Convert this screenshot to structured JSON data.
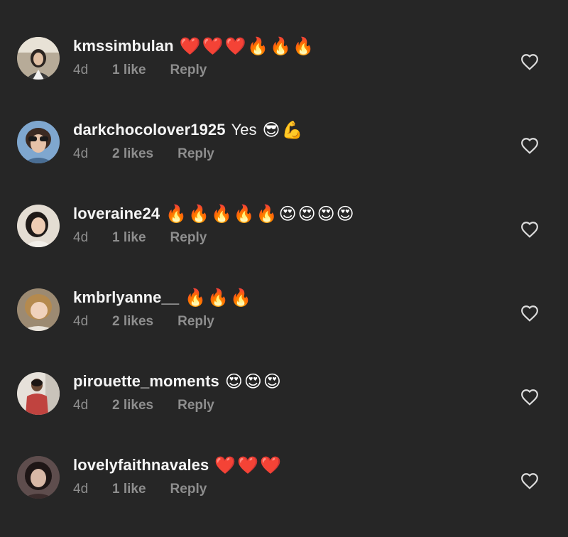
{
  "comments": [
    {
      "username": "kmssimbulan",
      "text": "",
      "emoji": "❤️❤️❤️🔥🔥🔥",
      "time": "4d",
      "likes": "1 like",
      "reply": "Reply",
      "avatar_color": "#6b5a4a"
    },
    {
      "username": "darkchocolover1925",
      "text": "Yes",
      "emoji": "😎💪",
      "time": "4d",
      "likes": "2 likes",
      "reply": "Reply",
      "avatar_color": "#5a7fa6"
    },
    {
      "username": "loveraine24",
      "text": "",
      "emoji": "🔥🔥🔥🔥🔥😍😍😍😍",
      "time": "4d",
      "likes": "1 like",
      "reply": "Reply",
      "avatar_color": "#c9b8a8"
    },
    {
      "username": "kmbrlyanne__",
      "text": "",
      "emoji": "🔥🔥🔥",
      "time": "4d",
      "likes": "2 likes",
      "reply": "Reply",
      "avatar_color": "#a89070"
    },
    {
      "username": "pirouette_moments",
      "text": "",
      "emoji": "😍😍😍",
      "time": "4d",
      "likes": "2 likes",
      "reply": "Reply",
      "avatar_color": "#d9d0c4"
    },
    {
      "username": "lovelyfaithnavales",
      "text": "",
      "emoji": "❤️❤️❤️",
      "time": "4d",
      "likes": "1 like",
      "reply": "Reply",
      "avatar_color": "#4a3a3a"
    }
  ],
  "icons": {
    "like": "heart-outline-icon"
  },
  "colors": {
    "background": "#262626",
    "username": "#f5f5f5",
    "meta": "#8e8e8e"
  }
}
